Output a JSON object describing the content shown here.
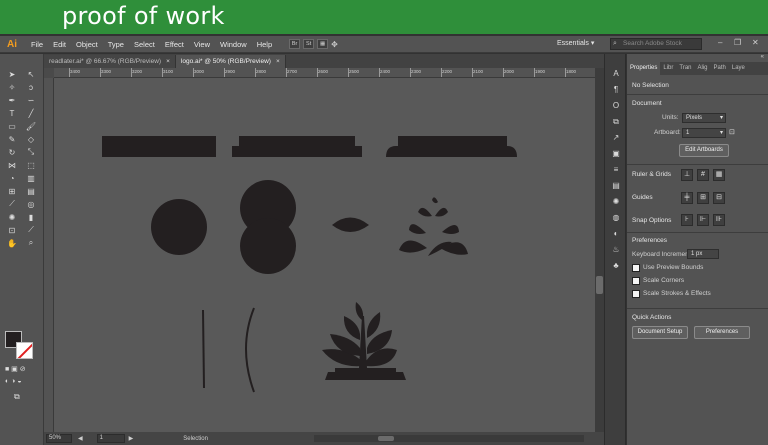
{
  "banner": {
    "title": "proof of work"
  },
  "app": {
    "logo": "Ai"
  },
  "menu": [
    "File",
    "Edit",
    "Object",
    "Type",
    "Select",
    "Effect",
    "View",
    "Window",
    "Help"
  ],
  "menu_tools": {
    "br": "Br",
    "st": "St"
  },
  "workspace": {
    "label": "Essentials ▾"
  },
  "search": {
    "placeholder": "Search Adobe Stock"
  },
  "tabs": [
    {
      "label": "readlater.ai* @ 66.67% (RGB/Preview)",
      "active": false
    },
    {
      "label": "logo.ai* @ 50% (RGB/Preview)",
      "active": true
    }
  ],
  "tab_close": "×",
  "ruler": {
    "top_ticks": [
      "3400",
      "3300",
      "3200",
      "3100",
      "3000",
      "2900",
      "2800",
      "2700",
      "2600",
      "2500",
      "2400",
      "2300",
      "2200",
      "2100",
      "2000",
      "1900",
      "1800",
      "1700",
      "1600"
    ]
  },
  "status": {
    "zoom": "50%",
    "page": "1",
    "mode": "Selection"
  },
  "panel": {
    "tabs": [
      "Properties",
      "Libr",
      "Tran",
      "Alig",
      "Path",
      "Laye"
    ],
    "no_selection": "No Selection",
    "document_heading": "Document",
    "units_label": "Units:",
    "units_value": "Pixels",
    "artboard_label": "Artboard:",
    "artboard_value": "1",
    "edit_artboards": "Edit Artboards",
    "ruler_grids": "Ruler & Grids",
    "guides": "Guides",
    "snap_options": "Snap Options",
    "preferences_heading": "Preferences",
    "keyboard_increment_label": "Keyboard Increment:",
    "keyboard_increment_value": "1 px",
    "use_preview_bounds": "Use Preview Bounds",
    "scale_corners": "Scale Corners",
    "scale_strokes": "Scale Strokes & Effects",
    "quick_actions": "Quick Actions",
    "document_setup": "Document Setup",
    "preferences_btn": "Preferences"
  },
  "colors": {
    "banner": "#2f8f3a",
    "canvas": "#595959",
    "shape": "#231f20",
    "accent_logo": "#f39c1f"
  }
}
